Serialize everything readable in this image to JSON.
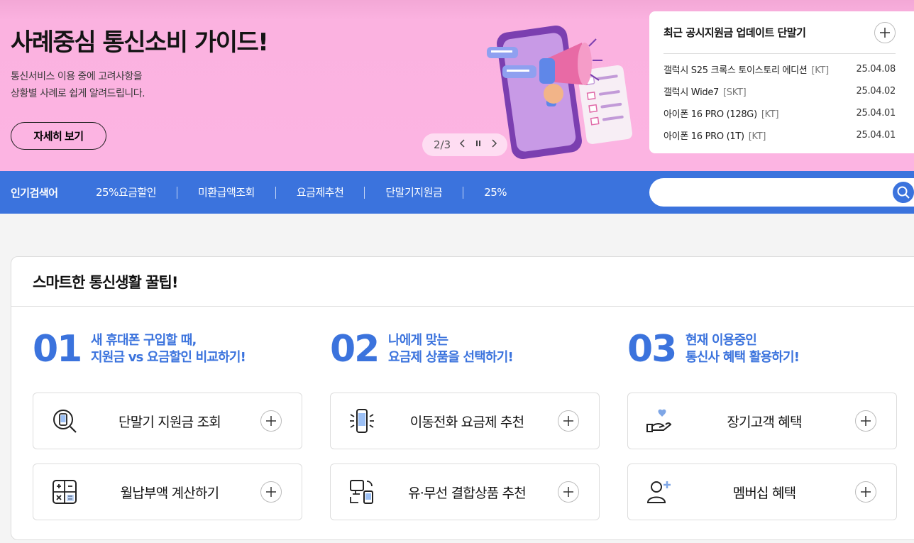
{
  "hero": {
    "title": "사례중심 통신소비 가이드!",
    "desc_line1": "통신서비스 이용 중에 고려사항을",
    "desc_line2": "상황별 사례로 쉽게 알려드립니다.",
    "button_label": "자세히 보기",
    "pager_text": "2/3"
  },
  "updates": {
    "title": "최근 공시지원금 업데이트 단말기",
    "items": [
      {
        "name": "갤럭시 S25 크록스 토이스토리 에디션",
        "carrier": "[KT]",
        "date": "25.04.08"
      },
      {
        "name": "갤럭시 Wide7",
        "carrier": "[SKT]",
        "date": "25.04.02"
      },
      {
        "name": "아이폰 16 PRO (128G)",
        "carrier": "[KT]",
        "date": "25.04.01"
      },
      {
        "name": "아이폰 16 PRO (1T)",
        "carrier": "[KT]",
        "date": "25.04.01"
      }
    ]
  },
  "search": {
    "label": "인기검색어",
    "keywords": [
      "25%요금할인",
      "미환급액조회",
      "요금제추천",
      "단말기지원금",
      "25%"
    ],
    "placeholder": ""
  },
  "tips": {
    "title": "스마트한 통신생활 꿀팁!",
    "columns": [
      {
        "num": "01",
        "line1": "새 휴대폰 구입할 때,",
        "line2": "지원금 vs 요금할인 비교하기!",
        "tiles": [
          {
            "label": "단말기 지원금 조회",
            "icon": "phone-search-icon"
          },
          {
            "label": "월납부액 계산하기",
            "icon": "calculator-icon"
          }
        ]
      },
      {
        "num": "02",
        "line1": "나에게 맞는",
        "line2": "요금제 상품을 선택하기!",
        "tiles": [
          {
            "label": "이동전화 요금제 추천",
            "icon": "phone-signal-icon"
          },
          {
            "label": "유·무선 결합상품 추천",
            "icon": "devices-combo-icon"
          }
        ]
      },
      {
        "num": "03",
        "line1": "현재 이용중인",
        "line2": "통신사 혜택 활용하기!",
        "tiles": [
          {
            "label": "장기고객 혜택",
            "icon": "heart-hand-icon"
          },
          {
            "label": "멤버십 혜택",
            "icon": "user-plus-icon"
          }
        ]
      }
    ]
  },
  "colors": {
    "accent": "#3b73dd",
    "hero_bg": "#fcb4e2"
  }
}
